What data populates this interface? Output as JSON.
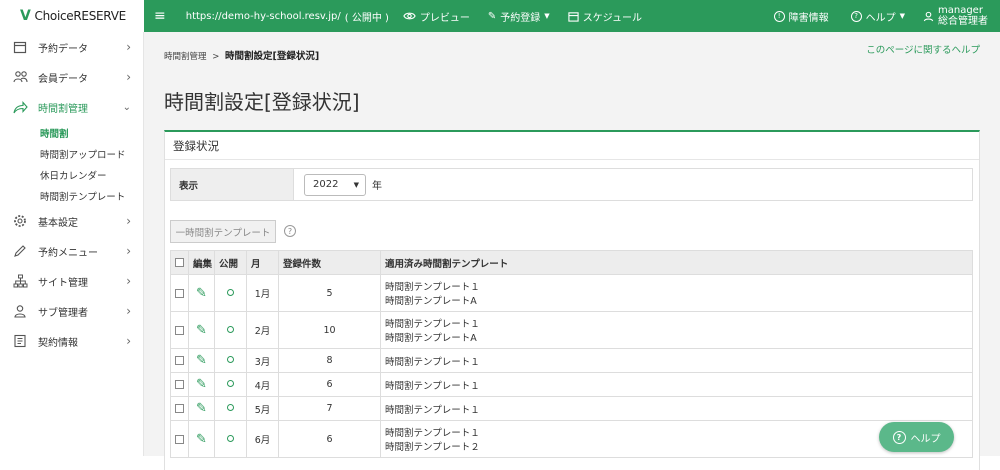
{
  "brand": {
    "name": "ChoiceRESERVE",
    "mark": "V"
  },
  "topbar": {
    "url": "https://demo-hy-school.resv.jp/",
    "url_status": "( 公開中 )",
    "preview": "プレビュー",
    "booking": "予約登録",
    "schedule": "スケジュール",
    "outage": "障害情報",
    "help": "ヘルプ",
    "user_line1": "manager",
    "user_line2": "総合管理者"
  },
  "sidebar": {
    "items": [
      {
        "label": "予約データ"
      },
      {
        "label": "会員データ"
      },
      {
        "label": "時間割管理"
      },
      {
        "label": "基本設定"
      },
      {
        "label": "予約メニュー"
      },
      {
        "label": "サイト管理"
      },
      {
        "label": "サブ管理者"
      },
      {
        "label": "契約情報"
      }
    ],
    "sub_items": [
      {
        "label": "時間割"
      },
      {
        "label": "時間割アップロード"
      },
      {
        "label": "休日カレンダー"
      },
      {
        "label": "時間割テンプレート"
      }
    ]
  },
  "breadcrumb": {
    "parent": "時間割管理",
    "sep": ">",
    "current": "時間割設定[登録状況]"
  },
  "help_link": "このページに関するヘルプ",
  "page_title": "時間割設定[登録状況]",
  "card": {
    "title": "登録状況",
    "filter_label": "表示",
    "year_value": "2022",
    "year_suffix": "年",
    "template_button": "一時間割テンプレート",
    "help_mark": "?"
  },
  "table": {
    "headers": {
      "edit": "編集",
      "public": "公開",
      "month": "月",
      "count": "登録件数",
      "templates": "適用済み時間割テンプレート"
    },
    "rows": [
      {
        "month": "1月",
        "count": "5",
        "t1": "時間割テンプレート１",
        "t2": "時間割テンプレートA"
      },
      {
        "month": "2月",
        "count": "10",
        "t1": "時間割テンプレート１",
        "t2": "時間割テンプレートA"
      },
      {
        "month": "3月",
        "count": "8",
        "t1": "時間割テンプレート１",
        "t2": ""
      },
      {
        "month": "4月",
        "count": "6",
        "t1": "時間割テンプレート１",
        "t2": ""
      },
      {
        "month": "5月",
        "count": "7",
        "t1": "時間割テンプレート１",
        "t2": ""
      },
      {
        "month": "6月",
        "count": "6",
        "t1": "時間割テンプレート１",
        "t2": "時間割テンプレート２"
      }
    ]
  },
  "fab": {
    "label": "ヘルプ",
    "mark": "?"
  },
  "colors": {
    "accent": "#2b9a5b",
    "fab": "#5bb88a"
  }
}
